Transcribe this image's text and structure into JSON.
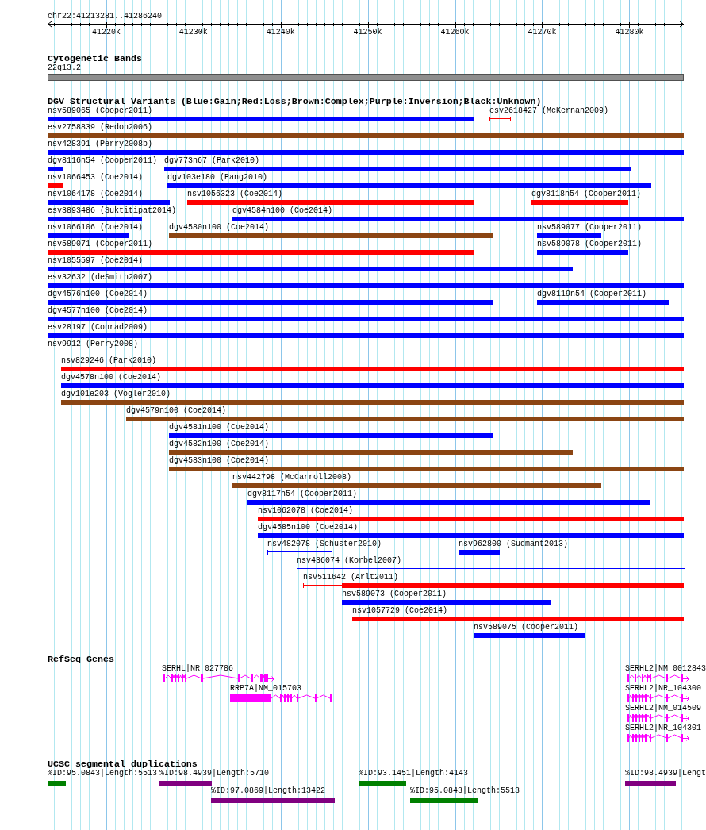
{
  "ruler": {
    "region": "chr22:41213281..41286240",
    "ticks": [
      "41220k",
      "41230k",
      "41240k",
      "41250k",
      "41260k",
      "41270k",
      "41280k"
    ]
  },
  "cytobands": {
    "title": "Cytogenetic Bands",
    "bands": [
      {
        "label": "22q13.2"
      }
    ]
  },
  "variants": {
    "title": "DGV Structural Variants (Blue:Gain;Red:Loss;Brown:Complex;Purple:Inversion;Black:Unknown)",
    "rows": [
      {
        "features": [
          {
            "label": "nsv589065 (Cooper2011)",
            "color": "#0000ff",
            "kind": "bar"
          },
          {
            "label": "esv2618427 (McKernan2009)",
            "color": "#ff0000",
            "kind": "interval"
          }
        ]
      },
      {
        "features": [
          {
            "label": "esv2758839 (Redon2006)",
            "color": "#8b4513",
            "kind": "bar"
          }
        ]
      },
      {
        "features": [
          {
            "label": "nsv428391 (Perry2008b)",
            "color": "#0000ff",
            "kind": "bar"
          }
        ]
      },
      {
        "features": [
          {
            "label": "dgv8116n54 (Cooper2011)",
            "color": "#0000ff",
            "kind": "bar"
          },
          {
            "label": "dgv773n67 (Park2010)",
            "color": "#0000ff",
            "kind": "bar"
          }
        ]
      },
      {
        "features": [
          {
            "label": "nsv1066453 (Coe2014)",
            "color": "#ff0000",
            "kind": "bar"
          },
          {
            "label": "dgv103e180 (Pang2010)",
            "color": "#0000ff",
            "kind": "bar"
          }
        ]
      },
      {
        "features": [
          {
            "label": "nsv1064178 (Coe2014)",
            "color": "#0000ff",
            "kind": "bar"
          },
          {
            "label": "nsv1056323 (Coe2014)",
            "color": "#ff0000",
            "kind": "bar"
          },
          {
            "label": "dgv8118n54 (Cooper2011)",
            "color": "#ff0000",
            "kind": "bar"
          }
        ]
      },
      {
        "features": [
          {
            "label": "esv3893486 (Suktitipat2014)",
            "color": "#0000ff",
            "kind": "bar"
          },
          {
            "label": "dgv4584n100 (Coe2014)",
            "color": "#0000ff",
            "kind": "bar"
          }
        ]
      },
      {
        "features": [
          {
            "label": "nsv1066106 (Coe2014)",
            "color": "#0000ff",
            "kind": "bar"
          },
          {
            "label": "dgv4580n100 (Coe2014)",
            "color": "#8b4513",
            "kind": "bar"
          },
          {
            "label": "nsv589077 (Cooper2011)",
            "color": "#0000ff",
            "kind": "bar"
          }
        ]
      },
      {
        "features": [
          {
            "label": "nsv589071 (Cooper2011)",
            "color": "#ff0000",
            "kind": "bar"
          },
          {
            "label": "nsv589078 (Cooper2011)",
            "color": "#0000ff",
            "kind": "bar"
          }
        ]
      },
      {
        "features": [
          {
            "label": "nsv1055597 (Coe2014)",
            "color": "#0000ff",
            "kind": "bar"
          }
        ]
      },
      {
        "features": [
          {
            "label": "esv32632 (deSmith2007)",
            "color": "#0000ff",
            "kind": "bar"
          }
        ]
      },
      {
        "features": [
          {
            "label": "dgv4576n100 (Coe2014)",
            "color": "#0000ff",
            "kind": "bar"
          },
          {
            "label": "dgv8119n54 (Cooper2011)",
            "color": "#0000ff",
            "kind": "bar"
          }
        ]
      },
      {
        "features": [
          {
            "label": "dgv4577n100 (Coe2014)",
            "color": "#0000ff",
            "kind": "bar"
          }
        ]
      },
      {
        "features": [
          {
            "label": "esv28197 (Conrad2009)",
            "color": "#0000ff",
            "kind": "bar"
          }
        ]
      },
      {
        "features": [
          {
            "label": "nsv9912 (Perry2008)",
            "color": "#8b4513",
            "kind": "interval"
          }
        ]
      },
      {
        "features": [
          {
            "label": "nsv829246 (Park2010)",
            "color": "#ff0000",
            "kind": "bar"
          }
        ]
      },
      {
        "features": [
          {
            "label": "dgv4578n100 (Coe2014)",
            "color": "#0000ff",
            "kind": "bar"
          }
        ]
      },
      {
        "features": [
          {
            "label": "dgv101e203 (Vogler2010)",
            "color": "#8b4513",
            "kind": "bar"
          }
        ]
      },
      {
        "features": [
          {
            "label": "dgv4579n100 (Coe2014)",
            "color": "#8b4513",
            "kind": "bar"
          }
        ]
      },
      {
        "features": [
          {
            "label": "dgv4581n100 (Coe2014)",
            "color": "#0000ff",
            "kind": "bar"
          }
        ]
      },
      {
        "features": [
          {
            "label": "dgv4582n100 (Coe2014)",
            "color": "#8b4513",
            "kind": "bar"
          }
        ]
      },
      {
        "features": [
          {
            "label": "dgv4583n100 (Coe2014)",
            "color": "#8b4513",
            "kind": "bar"
          }
        ]
      },
      {
        "features": [
          {
            "label": "nsv442798 (McCarroll2008)",
            "color": "#8b4513",
            "kind": "bar"
          }
        ]
      },
      {
        "features": [
          {
            "label": "dgv8117n54 (Cooper2011)",
            "color": "#0000ff",
            "kind": "bar"
          }
        ]
      },
      {
        "features": [
          {
            "label": "nsv1062078 (Coe2014)",
            "color": "#ff0000",
            "kind": "bar"
          }
        ]
      },
      {
        "features": [
          {
            "label": "dgv4585n100 (Coe2014)",
            "color": "#0000ff",
            "kind": "bar"
          }
        ]
      },
      {
        "features": [
          {
            "label": "nsv482078 (Schuster2010)",
            "color": "#0000ff",
            "kind": "interval"
          },
          {
            "label": "nsv962800 (Sudmant2013)",
            "color": "#0000ff",
            "kind": "bar"
          }
        ]
      },
      {
        "features": [
          {
            "label": "nsv436074 (Korbel2007)",
            "color": "#0000ff",
            "kind": "interval"
          }
        ]
      },
      {
        "features": [
          {
            "label": "nsv511642 (Arlt2011)",
            "color": "#ff0000",
            "kind": "partial"
          }
        ]
      },
      {
        "features": [
          {
            "label": "nsv589073 (Cooper2011)",
            "color": "#0000ff",
            "kind": "bar"
          }
        ]
      },
      {
        "features": [
          {
            "label": "nsv1057729 (Coe2014)",
            "color": "#ff0000",
            "kind": "bar"
          }
        ]
      },
      {
        "features": [
          {
            "label": "nsv589075 (Cooper2011)",
            "color": "#0000ff",
            "kind": "bar"
          }
        ]
      }
    ]
  },
  "genes": {
    "title": "RefSeq Genes",
    "rows": [
      {
        "features": [
          {
            "label": "SERHL|NR_027786"
          },
          {
            "label": "SERHL2|NM_0012843"
          }
        ]
      },
      {
        "features": [
          {
            "label": "RRP7A|NM_015703"
          },
          {
            "label": "SERHL2|NR_104300"
          }
        ]
      },
      {
        "features": [
          {
            "label": "SERHL2|NM_014509"
          }
        ]
      },
      {
        "features": [
          {
            "label": "SERHL2|NR_104301"
          }
        ]
      }
    ]
  },
  "segmental_duplications": {
    "title": "UCSC segmental duplications",
    "rows": [
      {
        "features": [
          {
            "label": "%ID:95.0843|Length:5513",
            "color": "#008000"
          },
          {
            "label": "%ID:98.4939|Length:5710",
            "color": "#800080"
          },
          {
            "label": "%ID:93.1451|Length:4143",
            "color": "#008000"
          },
          {
            "label": "%ID:98.4939|Lengt",
            "color": "#800080"
          }
        ]
      },
      {
        "features": [
          {
            "label": "%ID:97.0869|Length:13422",
            "color": "#800080"
          },
          {
            "label": "%ID:95.0843|Length:5513",
            "color": "#008000"
          }
        ]
      }
    ]
  }
}
